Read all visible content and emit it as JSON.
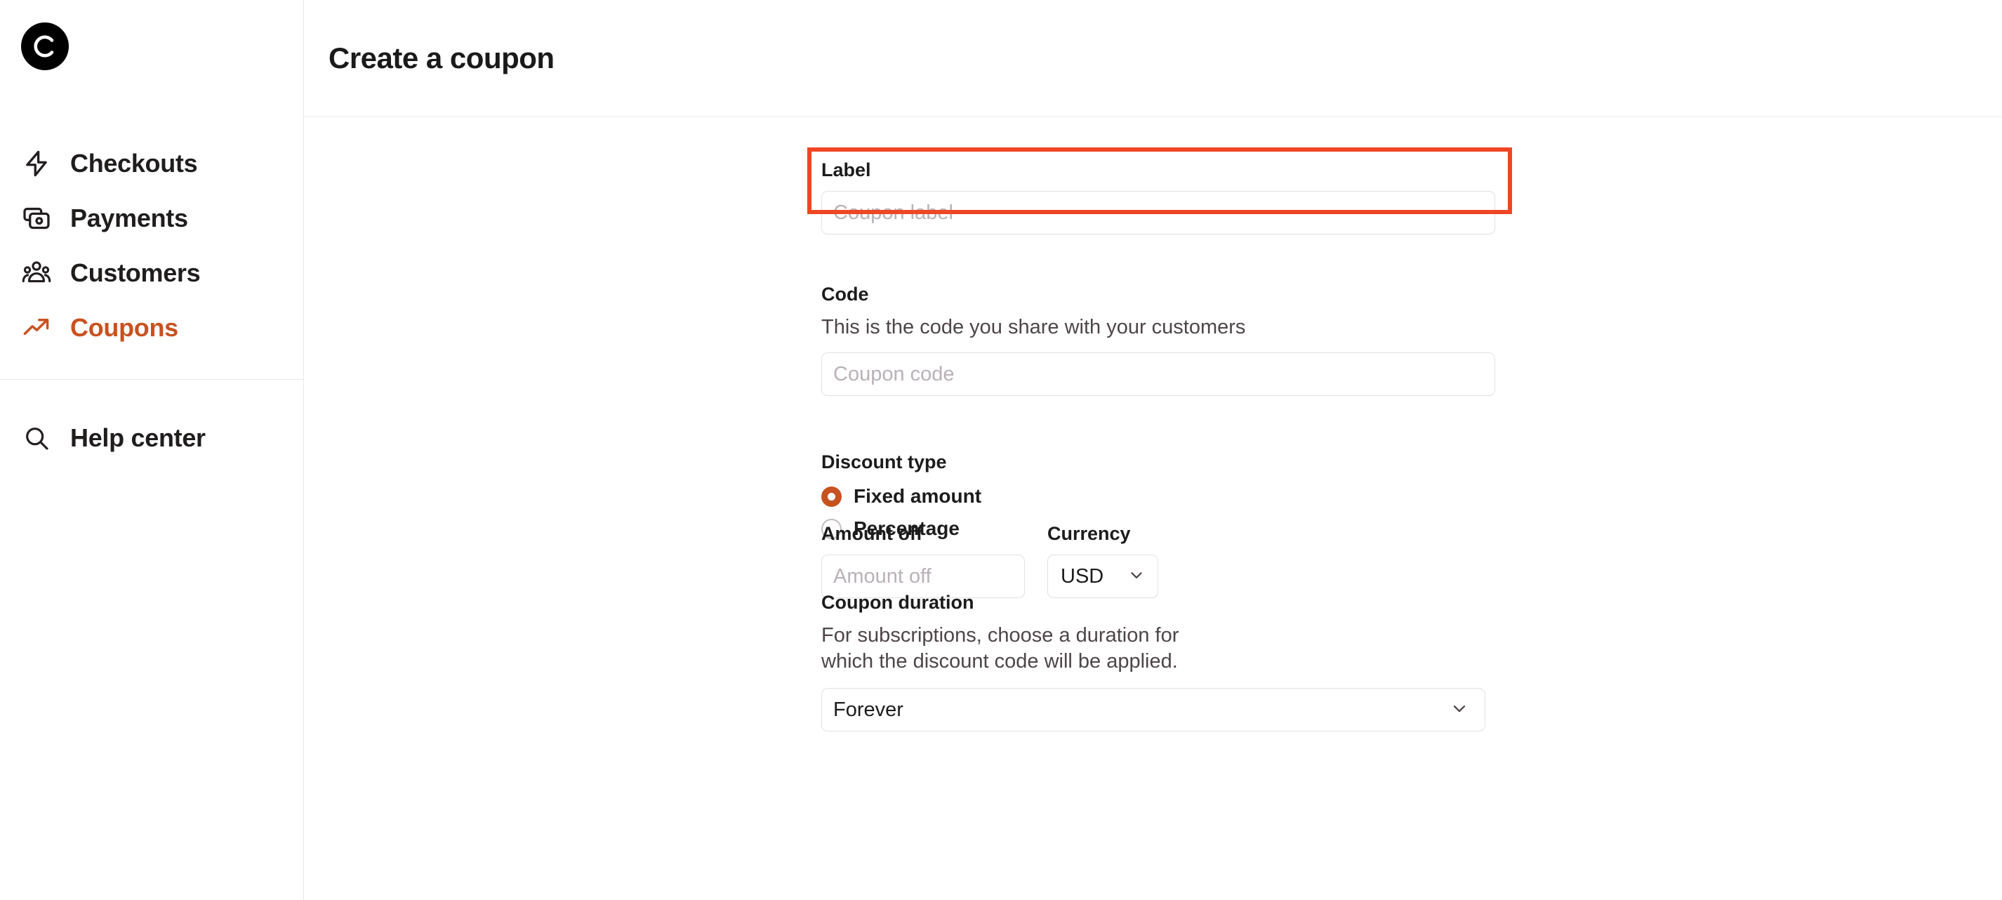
{
  "brand": {
    "logo_icon": "circle-c-logo",
    "accent_color": "#c8521f",
    "highlight_color": "#ef4623"
  },
  "sidebar": {
    "items": [
      {
        "label": "Checkouts",
        "icon": "lightning-bolt-icon",
        "active": false
      },
      {
        "label": "Payments",
        "icon": "credit-cards-icon",
        "active": false
      },
      {
        "label": "Customers",
        "icon": "people-group-icon",
        "active": false
      },
      {
        "label": "Coupons",
        "icon": "trending-up-icon",
        "active": true
      }
    ],
    "help": {
      "label": "Help center",
      "icon": "search-icon"
    }
  },
  "header": {
    "title": "Create a coupon"
  },
  "form": {
    "label_field": {
      "label": "Label",
      "placeholder": "Coupon label",
      "value": ""
    },
    "code_field": {
      "label": "Code",
      "description": "This is the code you share with your customers",
      "placeholder": "Coupon code",
      "value": ""
    },
    "discount_type": {
      "label": "Discount type",
      "options": [
        {
          "label": "Fixed amount",
          "selected": true
        },
        {
          "label": "Percentage",
          "selected": false
        }
      ]
    },
    "amount_off": {
      "label": "Amount off",
      "placeholder": "Amount off",
      "value": ""
    },
    "currency": {
      "label": "Currency",
      "value": "USD",
      "chevron_icon": "chevron-down-icon"
    },
    "coupon_duration": {
      "label": "Coupon duration",
      "description": "For subscriptions, choose a duration for which the discount code will be applied.",
      "value": "Forever",
      "chevron_icon": "chevron-down-icon"
    }
  }
}
